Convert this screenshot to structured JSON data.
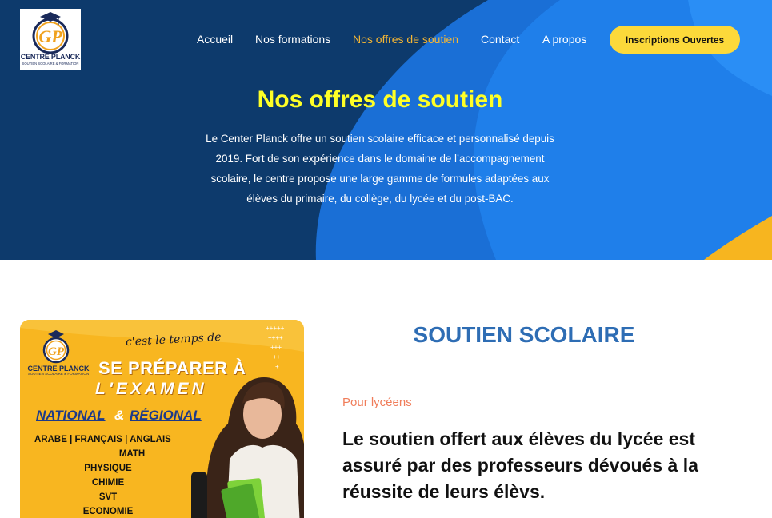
{
  "logo": {
    "name": "CENTRE PLANCK",
    "tagline": "SOUTIEN SCOLAIRE & FORMATION",
    "monogram": "CP"
  },
  "nav": {
    "items": [
      {
        "label": "Accueil"
      },
      {
        "label": "Nos formations"
      },
      {
        "label": "Nos offres de soutien",
        "active": true
      },
      {
        "label": "Contact"
      },
      {
        "label": "A propos"
      }
    ],
    "cta_label": "Inscriptions Ouvertes"
  },
  "hero": {
    "title": "Nos offres de soutien",
    "text": "Le Center Planck offre un soutien scolaire efficace et personnalisé depuis 2019. Fort de son expérience dans le domaine de l’accompagnement scolaire, le centre propose une large gamme de formules adaptées aux élèves du primaire, du collège, du lycée et du post-BAC."
  },
  "poster": {
    "logo_name": "CENTRE PLANCK",
    "logo_tagline": "SOUTIEN SCOLAIRE & FORMATION",
    "headline_script": "c'est le temps de",
    "headline_1": "SE PRÉPARER À",
    "headline_2": "L'EXAMEN",
    "national": "NATIONAL",
    "amp": "&",
    "regional": "RÉGIONAL",
    "subjects_line": "ARABE | FRANÇAIS | ANGLAIS",
    "subjects": [
      "MATH",
      "PHYSIQUE",
      "CHIMIE",
      "SVT",
      "ECONOMIE"
    ]
  },
  "section": {
    "title": "SOUTIEN SCOLAIRE",
    "subtitle": "Pour lycéens",
    "body": "Le soutien offert aux élèves du lycée est assuré par des professeurs dévoués à la réussite de leurs élèvs."
  },
  "colors": {
    "hero_bg": "#0d3a6c",
    "hero_blue": "#1a7ae8",
    "accent_yellow": "#fcd93a",
    "hero_title": "#ffff26",
    "active_nav": "#f7b733",
    "section_title": "#2e6db4",
    "subtitle": "#f07d5a",
    "poster_bg": "#f8b620"
  }
}
